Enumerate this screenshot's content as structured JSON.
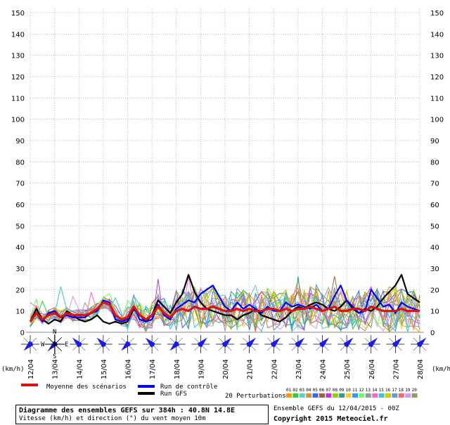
{
  "chart_data": {
    "type": "line",
    "title": "Diagramme des ensembles GEFS sur 384h : 40.8N 14.8E",
    "subtitle": "Vitesse (km/h) et direction (°) du vent moyen 10m",
    "yunit_left": "(km/h)",
    "yunit_right": "(km/h",
    "ylim": [
      0,
      150
    ],
    "y_ticks": [
      0,
      10,
      20,
      30,
      40,
      50,
      60,
      70,
      80,
      90,
      100,
      110,
      120,
      130,
      140,
      150
    ],
    "x_tick_labels": [
      "12/04",
      "13/04",
      "14/04",
      "15/04",
      "16/04",
      "17/04",
      "18/04",
      "19/04",
      "20/04",
      "21/04",
      "22/04",
      "23/04",
      "24/04",
      "25/04",
      "26/04",
      "27/04",
      "28/04"
    ],
    "step_hours": 6,
    "steps": 65,
    "grid": true,
    "legend": {
      "mean": "Moyenne des scénarios",
      "control": "Run de contrôle",
      "gfs": "Run GFS",
      "perturbations": "20 Perturbations",
      "perturbation_ids": [
        "01",
        "02",
        "03",
        "04",
        "05",
        "06",
        "07",
        "08",
        "09",
        "10",
        "11",
        "12",
        "13",
        "14",
        "15",
        "16",
        "17",
        "18",
        "19",
        "20"
      ]
    },
    "series": [
      {
        "name": "Moyenne des scénarios",
        "color": "#dd1111",
        "values": [
          5,
          9,
          6,
          8,
          9,
          7,
          9,
          8,
          8,
          8,
          9,
          11,
          14,
          13,
          8,
          6,
          7,
          12,
          8,
          6,
          8,
          12,
          9,
          7,
          10,
          11,
          10,
          12,
          11,
          11,
          12,
          11,
          10,
          10,
          11,
          10,
          11,
          10,
          10,
          11,
          11,
          10,
          11,
          10,
          11,
          11,
          12,
          11,
          10,
          11,
          12,
          10,
          10,
          11,
          11,
          10,
          12,
          11,
          10,
          10,
          10,
          11,
          10,
          10,
          10
        ]
      },
      {
        "name": "Run de contrôle",
        "color": "#0000ff",
        "values": [
          5,
          9,
          5,
          9,
          10,
          7,
          8,
          7,
          7,
          7,
          9,
          10,
          15,
          14,
          6,
          5,
          6,
          12,
          6,
          5,
          6,
          13,
          8,
          6,
          11,
          13,
          15,
          14,
          18,
          20,
          22,
          17,
          12,
          10,
          14,
          11,
          13,
          11,
          9,
          12,
          10,
          10,
          14,
          12,
          13,
          12,
          11,
          13,
          10,
          11,
          17,
          22,
          15,
          12,
          9,
          10,
          20,
          16,
          12,
          13,
          9,
          14,
          12,
          11,
          10
        ]
      },
      {
        "name": "Run GFS",
        "color": "#000000",
        "values": [
          5,
          11,
          6,
          4,
          6,
          5,
          10,
          8,
          6,
          5,
          6,
          8,
          5,
          4,
          5,
          4,
          5,
          11,
          8,
          5,
          8,
          15,
          12,
          9,
          14,
          18,
          27,
          19,
          14,
          11,
          10,
          9,
          8,
          8,
          6,
          8,
          9,
          11,
          8,
          7,
          6,
          5,
          7,
          10,
          12,
          11,
          13,
          14,
          13,
          11,
          10,
          12,
          15,
          11,
          9,
          11,
          10,
          12,
          16,
          19,
          22,
          27,
          18,
          16,
          14
        ]
      }
    ],
    "wind_direction_deg": [
      225,
      225,
      315,
      315,
      225,
      315,
      225,
      45,
      45,
      45,
      45,
      45,
      45,
      45,
      45,
      45,
      45
    ]
  }
}
